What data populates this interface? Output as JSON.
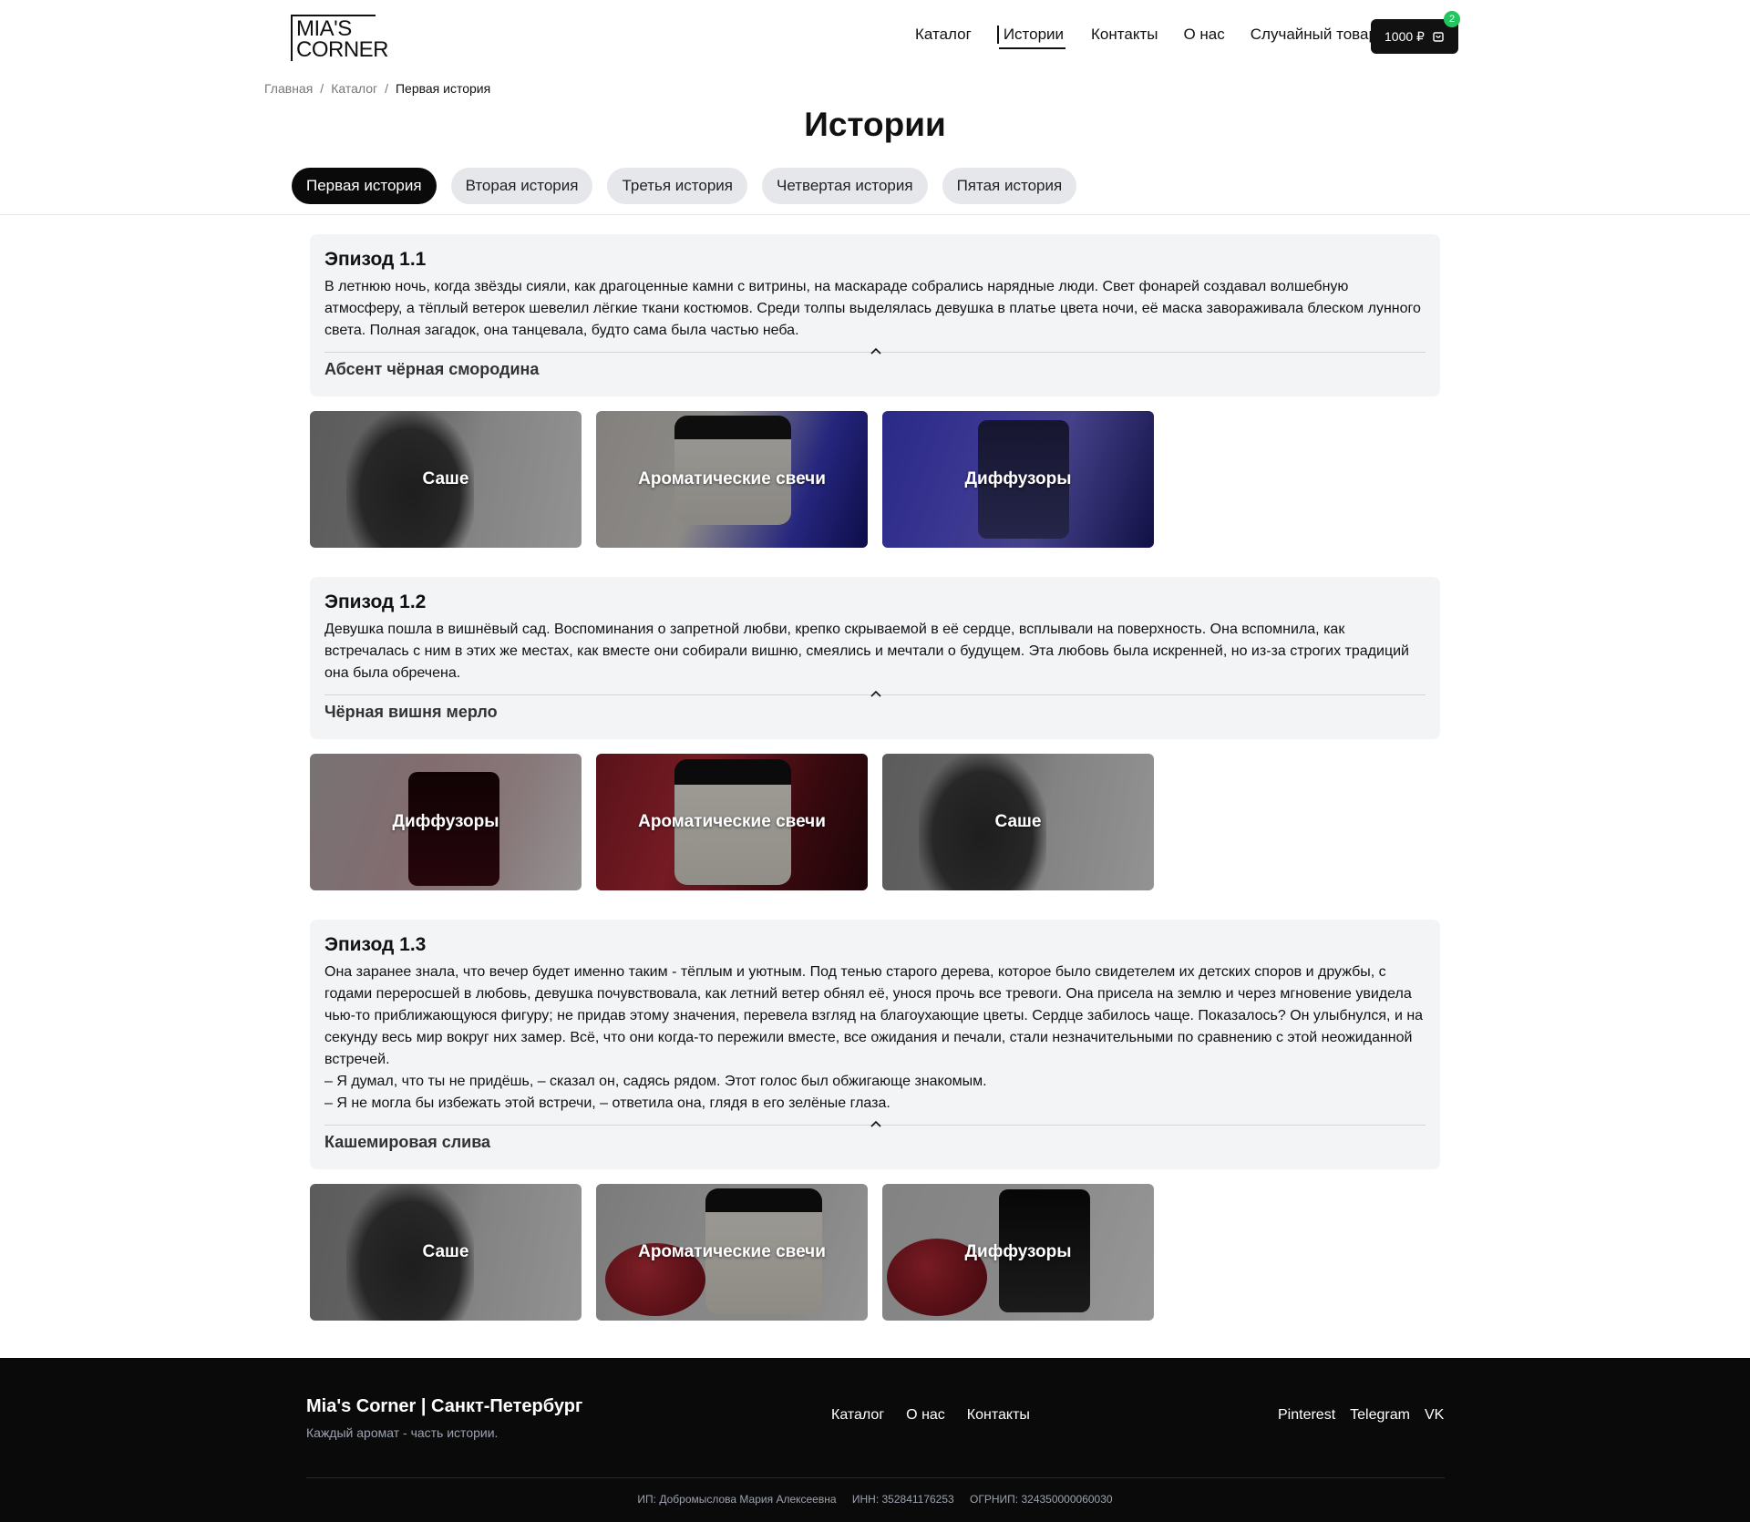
{
  "header": {
    "logo": {
      "line1": "MIA'S",
      "line2": "CORNER"
    },
    "nav": [
      "Каталог",
      "Истории",
      "Контакты",
      "О нас",
      "Случайный товар"
    ],
    "nav_active": "Истории",
    "cart": {
      "amount": "1000 ₽",
      "count": "2"
    }
  },
  "breadcrumb": {
    "items": [
      "Главная",
      "Каталог"
    ],
    "current": "Первая история",
    "separator": "/"
  },
  "page_title": "Истории",
  "tabs": [
    "Первая история",
    "Вторая история",
    "Третья история",
    "Четвертая история",
    "Пятая история"
  ],
  "tabs_active": "Первая история",
  "episodes": [
    {
      "title": "Эпизод 1.1",
      "text": "В летнюю ночь, когда звёзды сияли, как драгоценные камни с витрины, на маскараде собрались нарядные люди. Свет фонарей создавал волшебную атмосферу, а тёплый ветерок шевелил лёгкие ткани костюмов. Среди толпы выделялась девушка в платье цвета ночи, её маска завораживала блеском лунного света. Полная загадок, она танцевала, будто сама была частью неба.",
      "scent": "Абсент чёрная смородина",
      "cards": [
        "Саше",
        "Ароматические свечи",
        "Диффузоры"
      ]
    },
    {
      "title": "Эпизод 1.2",
      "text": "Девушка пошла в вишнёвый сад. Воспоминания о запретной любви, крепко скрываемой в её сердце, всплывали на поверхность. Она вспомнила, как встречалась с ним в этих же местах, как вместе они собирали вишню, смеялись и мечтали о будущем. Эта любовь была искренней, но из-за строгих традиций она была обречена.",
      "scent": "Чёрная вишня мерло",
      "cards": [
        "Диффузоры",
        "Ароматические свечи",
        "Саше"
      ]
    },
    {
      "title": "Эпизод 1.3",
      "text": "Она заранее знала, что вечер будет именно таким - тёплым и уютным. Под тенью старого дерева, которое было свидетелем их детских споров и дружбы, с годами переросшей в любовь, девушка почувствовала, как летний ветер обнял её, унося прочь все тревоги. Она присела на землю и через мгновение увидела чью-то приближающуюся фигуру; не придав этому значения, перевела взгляд на благоухающие цветы.  Сердце забилось чаще. Показалось?  Он улыбнулся, и на секунду весь мир вокруг них замер. Всё, что они когда-то пережили вместе, все ожидания и печали, стали незначительными по сравнению с этой неожиданной встречей.",
      "dialog1": "– Я думал, что ты не придёшь, – сказал он, садясь рядом. Этот голос был обжигающе знакомым.",
      "dialog2": "– Я не могла бы избежать этой встречи, – ответила она, глядя в его зелёные глаза.",
      "scent": "Кашемировая слива",
      "cards": [
        "Саше",
        "Ароматические свечи",
        "Диффузоры"
      ]
    }
  ],
  "footer": {
    "brand": "Mia's Corner | Санкт-Петербург",
    "tagline": "Каждый аромат - часть истории.",
    "links": [
      "Каталог",
      "О нас",
      "Контакты"
    ],
    "social": [
      "Pinterest",
      "Telegram",
      "VK"
    ],
    "legal": [
      "ИП: Добромыслова Мария Алексеевна",
      "ИНН: 352841176253",
      "ОГРНИП: 324350000060030"
    ]
  },
  "colors": {
    "accent": "#0a0a0a",
    "panel": "#f3f4f6",
    "tab_inactive": "#e5e7eb",
    "badge": "#22c55e"
  },
  "icons": {
    "cart": "shopping-bag-icon",
    "collapse": "chevron-up-icon"
  }
}
